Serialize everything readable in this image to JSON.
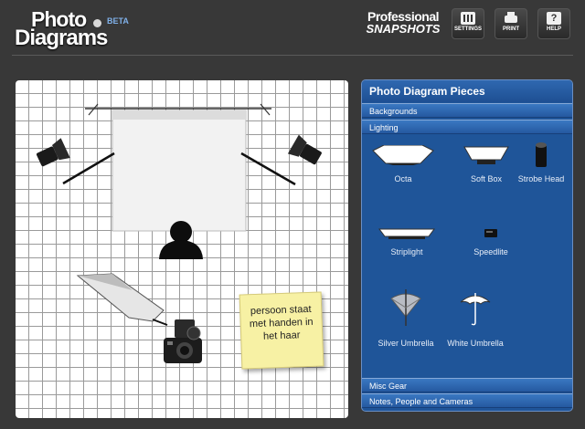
{
  "app": {
    "logo_line1": "Photo",
    "logo_line2": "Diagrams",
    "beta": "BETA",
    "brand_line1": "Professional",
    "brand_line2": "SNAPSHOTS"
  },
  "toolbar": {
    "settings_label": "SETTINGS",
    "print_label": "PRINT",
    "help_label": "HELP",
    "help_glyph": "?"
  },
  "canvas": {
    "note_text": "persoon staat met handen in het haar"
  },
  "panel": {
    "title": "Photo Diagram Pieces",
    "sections": {
      "backgrounds": "Backgrounds",
      "lighting": "Lighting",
      "misc": "Misc Gear",
      "notes": "Notes, People and Cameras"
    },
    "lighting_items": [
      {
        "label": "Octa",
        "icon": "octa-icon"
      },
      {
        "label": "Soft Box",
        "icon": "softbox-icon"
      },
      {
        "label": "Strobe Head",
        "icon": "strobe-head-icon"
      },
      {
        "label": "Striplight",
        "icon": "striplight-icon"
      },
      {
        "label": "Speedlite",
        "icon": "speedlite-icon"
      },
      {
        "label": "Silver Umbrella",
        "icon": "silver-umbrella-icon"
      },
      {
        "label": "White Umbrella",
        "icon": "white-umbrella-icon"
      }
    ]
  },
  "colors": {
    "app_background": "#383838",
    "panel_blue": "#1f5599",
    "accordion_blue": "#2f6cb5",
    "sticky_note": "#f7f1a4"
  }
}
